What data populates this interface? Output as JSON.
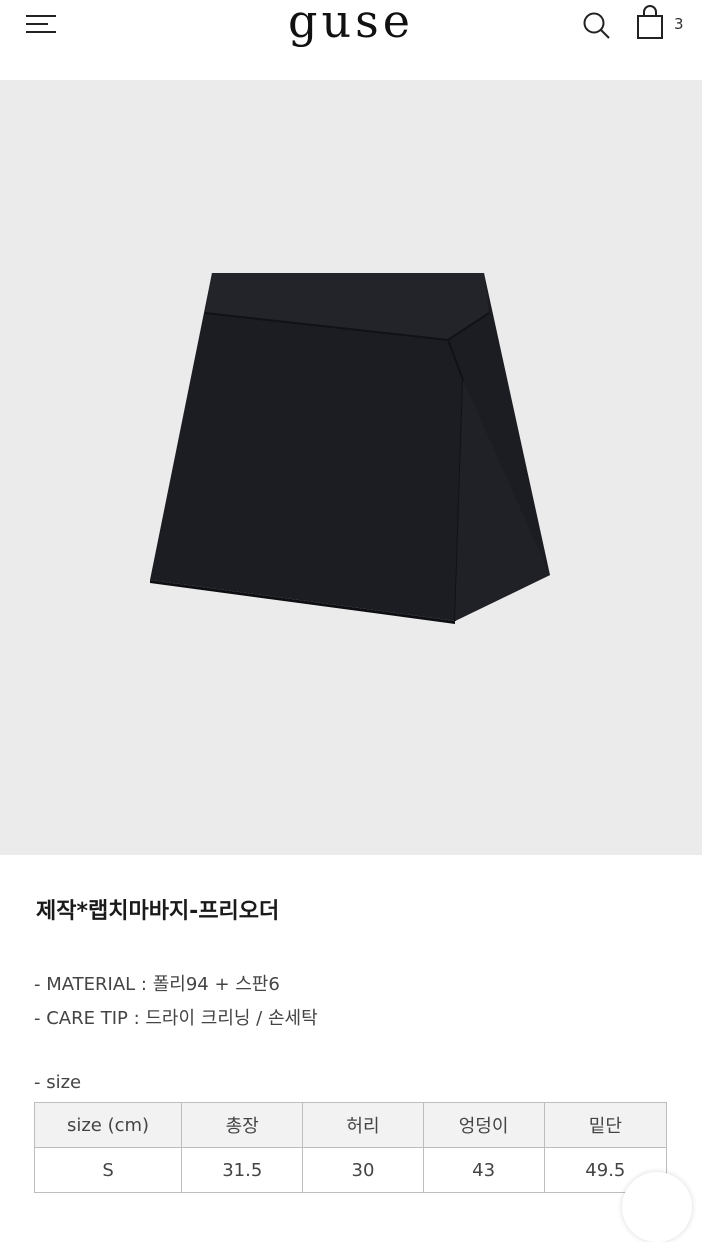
{
  "header": {
    "logo": "guse",
    "menu_icon": "hamburger-menu-icon",
    "search_icon": "search-icon",
    "cart_icon": "shopping-bag-icon",
    "cart_count": "3"
  },
  "product": {
    "image": "black-wrap-skirt-pants-photo",
    "title": "제작*랩치마바지-프리오더",
    "info": [
      "- MATERIAL : 폴리94 + 스판6",
      "- CARE TIP : 드라이 크리닝 / 손세탁"
    ],
    "size_label": "- size",
    "size_table": {
      "headers": [
        "size (cm)",
        "총장",
        "허리",
        "엉덩이",
        "밑단"
      ],
      "rows": [
        [
          "S",
          "31.5",
          "30",
          "43",
          "49.5"
        ]
      ]
    }
  },
  "colors": {
    "background": "#ffffff",
    "hero_background": "#ebebeb",
    "product": "#1c1d22"
  }
}
